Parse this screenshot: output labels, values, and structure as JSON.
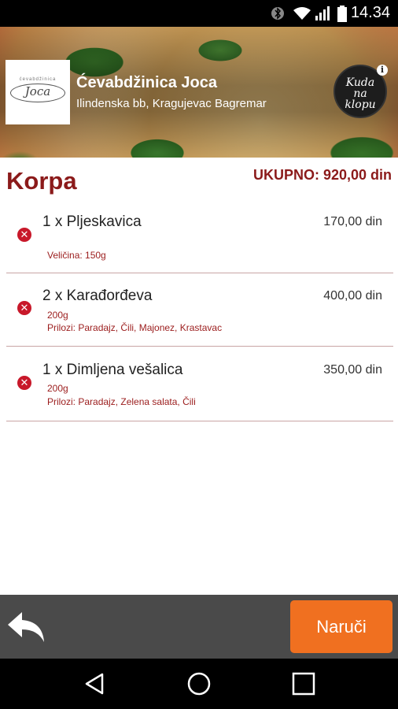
{
  "status_bar": {
    "time": "14.34",
    "icons": [
      "bluetooth-icon",
      "wifi-icon",
      "signal-icon",
      "battery-icon"
    ]
  },
  "header": {
    "logo_text": "Joca",
    "logo_small_text": "ćevabdžinica",
    "restaurant_name": "Ćevabdžinica Joca",
    "address": "Ilindenska bb, Kragujevac Bagremar",
    "badge_lines": [
      "Kuda",
      "na",
      "klopu"
    ],
    "info_symbol": "i"
  },
  "cart": {
    "title": "Korpa",
    "total_label": "UKUPNO: 920,00 din",
    "items": [
      {
        "name": "1 x Pljeskavica",
        "price": "170,00 din",
        "details": [
          "Veličina: 150g"
        ]
      },
      {
        "name": "2 x Karađorđeva",
        "price": "400,00 din",
        "details": [
          "200g",
          "Prilozi: Paradajz, Čili, Majonez, Krastavac"
        ]
      },
      {
        "name": "1 x Dimljena vešalica",
        "price": "350,00 din",
        "details": [
          "200g",
          "Prilozi: Paradajz, Zelena salata, Čili"
        ]
      }
    ]
  },
  "bottom": {
    "order_label": "Naruči"
  },
  "colors": {
    "accent": "#8b1a1a",
    "order_button": "#f07020",
    "remove_icon": "#c8182a",
    "bottom_bar": "#4a4a4a"
  }
}
